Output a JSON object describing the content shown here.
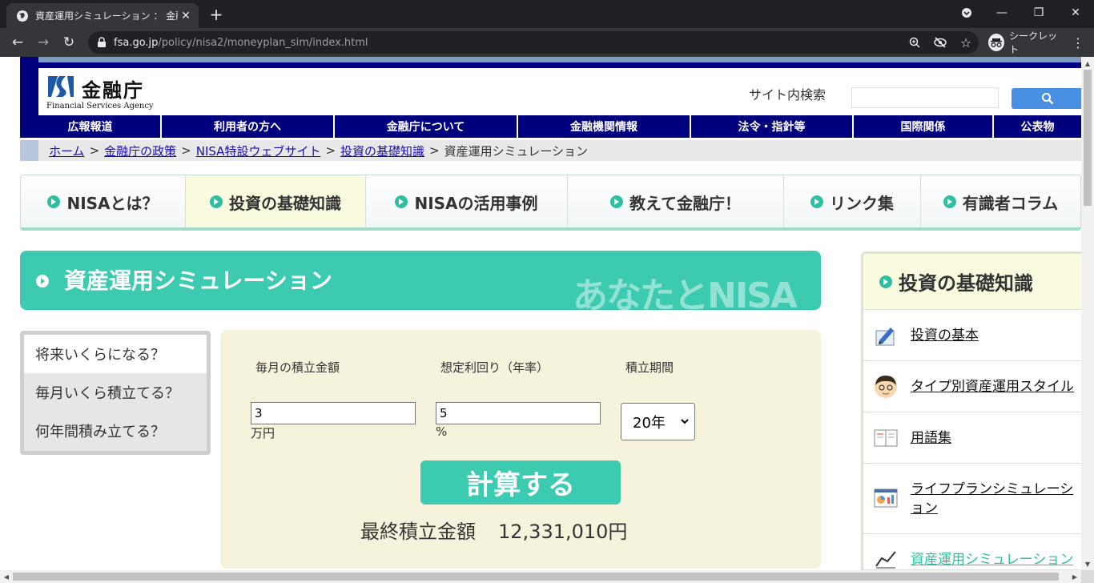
{
  "browser": {
    "tab_title": "資産運用シミュレーション ： 金融庁",
    "url_host": "fsa.go.jp",
    "url_path": "/policy/nisa2/moneyplan_sim/index.html",
    "incognito_label": "シークレット"
  },
  "header": {
    "logo_name": "金融庁",
    "logo_en": "Financial Services Agency",
    "search_label": "サイト内検索",
    "search_value": ""
  },
  "global_nav": [
    "広報報道",
    "利用者の方へ",
    "金融庁について",
    "金融機関情報",
    "法令・指針等",
    "国際関係",
    "公表物"
  ],
  "breadcrumb": {
    "links": [
      "ホーム",
      "金融庁の政策",
      "NISA特設ウェブサイト",
      "投資の基礎知識"
    ],
    "current": "資産運用シミュレーション",
    "separator": ">"
  },
  "nisa_tabs": [
    "NISAとは？",
    "投資の基礎知識",
    "NISAの活用事例",
    "教えて金融庁！",
    "リンク集",
    "有識者コラム"
  ],
  "banner": {
    "title": "資産運用シミュレーション",
    "watermark": "あなたとNISA"
  },
  "side_menu": [
    "将来いくらになる？",
    "毎月いくら積立てる？",
    "何年間積み立てる？"
  ],
  "calculator": {
    "monthly_label": "毎月の積立金額",
    "monthly_value": "3",
    "monthly_unit": "万円",
    "rate_label": "想定利回り（年率）",
    "rate_value": "5",
    "rate_unit": "%",
    "period_label": "積立期間",
    "period_value": "20年",
    "calc_button": "計算する",
    "result_label": "最終積立金額",
    "result_value": "12,331,010円"
  },
  "right_sidebar": {
    "title": "投資の基礎知識",
    "items": [
      "投資の基本",
      "タイプ別資産運用スタイル",
      "用語集",
      "ライフプランシミュレーション",
      "資産運用シミュレーション"
    ]
  },
  "colors": {
    "navy": "#00007f",
    "teal": "#3ccbb0",
    "cream": "#f5f3dc"
  }
}
